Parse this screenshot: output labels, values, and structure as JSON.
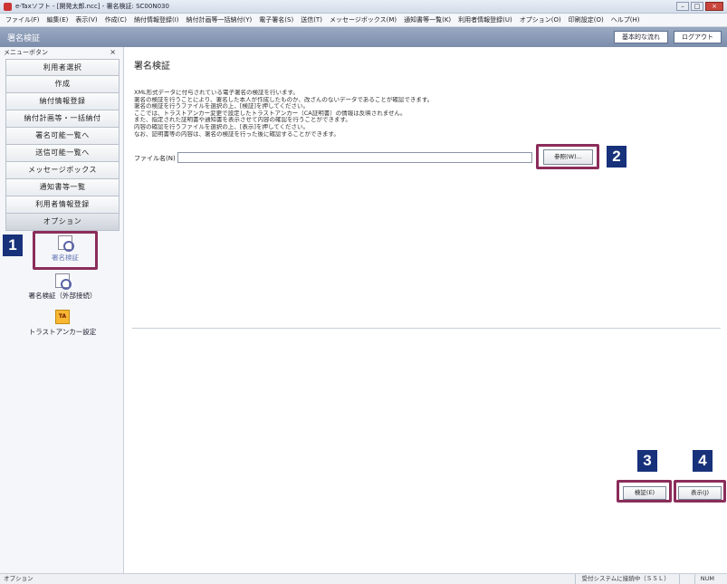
{
  "titlebar": {
    "title": "e-Taxソフト - [開発太郎.ncc] - 署名検証: SC00N030"
  },
  "menubar": {
    "items": [
      "ファイル(F)",
      "編集(E)",
      "表示(V)",
      "作成(C)",
      "納付情報登録(I)",
      "納付計画等一括納付(Y)",
      "電子署名(S)",
      "送信(T)",
      "メッセージボックス(M)",
      "通知書等一覧(K)",
      "利用者情報登録(U)",
      "オプション(O)",
      "印刷設定(O)",
      "ヘルプ(H)"
    ]
  },
  "header": {
    "title": "署名検証",
    "flow_button": "基本的な流れ",
    "logout_button": "ログアウト"
  },
  "sidebar": {
    "heading": "メニューボタン",
    "close": "×",
    "buttons": [
      "利用者選択",
      "作成",
      "納付情報登録",
      "納付計画等・一括納付",
      "署名可能一覧へ",
      "送信可能一覧へ",
      "メッセージボックス",
      "通知書等一覧",
      "利用者情報登録",
      "オプション"
    ],
    "options": [
      {
        "label": "署名検証",
        "icon": "document-magnifier-icon"
      },
      {
        "label": "署名検証（外部接続）",
        "icon": "document-magnifier-icon"
      },
      {
        "label": "トラストアンカー設定",
        "icon": "trust-anchor-icon"
      }
    ]
  },
  "main": {
    "title": "署名検証",
    "description": [
      "XML形式データに付与されている電子署名の検証を行います。",
      "署名の検証を行うことにより、署名した本人が作成したものか、改ざんのないデータであることが確認できます。",
      "署名の検証を行うファイルを選択の上、[検証]を押してください。",
      "ここでは、トラストアンカー変更で設定したトラストアンカー（CA証明書）の情報は反映されません。",
      "また、指定された証明書や通知書を表示させて内容の確認を行うことができます。",
      "内容の確認を行うファイルを選択の上、[表示]を押してください。",
      "なお、証明書等の内容は、署名の検証を行った後に確認することができます。"
    ],
    "file_label": "ファイル名(N)",
    "file_value": "",
    "browse_button": "参照(W)...",
    "verify_button": "検証(E)",
    "display_button": "表示(J)"
  },
  "statusbar": {
    "left": "オプション",
    "cells": [
      "受付システムに接続中（ＳＳＬ）",
      "",
      "NUM"
    ]
  },
  "callouts": [
    "1",
    "2",
    "3",
    "4"
  ],
  "colors": {
    "callout_border": "#8b2d5a",
    "badge_bg": "#17317a",
    "header_bg": "#7c8eab"
  }
}
